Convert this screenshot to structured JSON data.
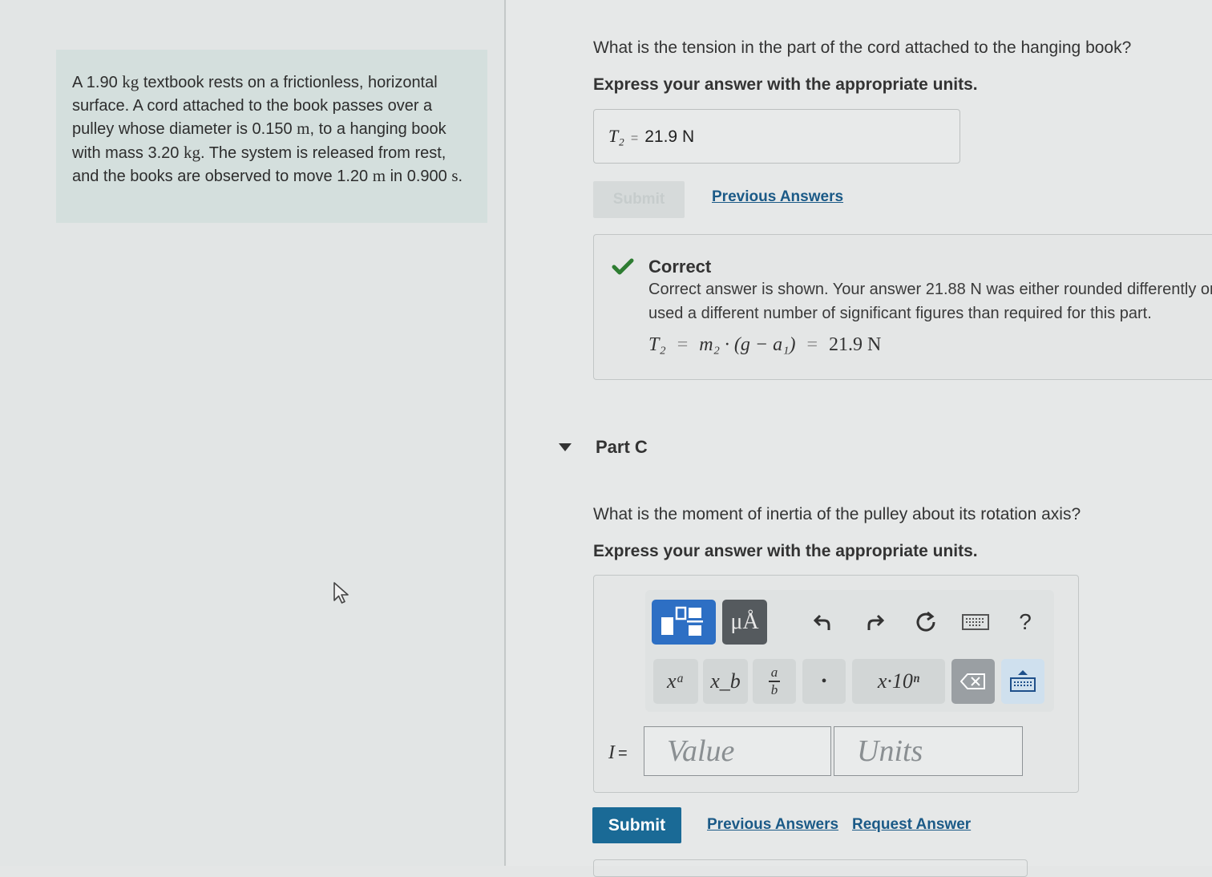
{
  "problem": {
    "seg1": "A 1.90 ",
    "u1": "kg",
    "seg2": " textbook rests on a frictionless, horizontal surface. A cord attached to the book passes over a pulley whose diameter is 0.150 ",
    "u2": "m",
    "seg3": ", to a hanging book with mass 3.20 ",
    "u3": "kg",
    "seg4": ". The system is released from rest, and the books are observed to move 1.20 ",
    "u4": "m",
    "seg5": " in 0.900 ",
    "u5": "s",
    "seg6": "."
  },
  "part_b": {
    "question": "What is the tension in the part of the cord attached to the hanging book?",
    "instruction": "Express your answer with the appropriate units.",
    "answer_var": "T₂",
    "answer_eq": "=",
    "answer_value": "21.9 N",
    "submit_label": "Submit",
    "previous_answers_label": "Previous Answers",
    "feedback": {
      "title": "Correct",
      "message": "Correct answer is shown. Your answer 21.88 N was either rounded differently or used a different number of significant figures than required for this part.",
      "equation_lhs": "T₂",
      "equation_mid": "m₂ · (g − a₁)",
      "equation_rhs": "21.9 N",
      "equals": "="
    }
  },
  "part_c": {
    "label": "Part C",
    "question": "What is the moment of inertia of the pulley about its rotation axis?",
    "instruction": "Express your answer with the appropriate units.",
    "toolbar": {
      "units_button": "μÅ",
      "help_label": "?",
      "keys": {
        "superscript": "xᵃ",
        "subscript": "x_b",
        "fraction_num": "a",
        "fraction_den": "b",
        "dot": "•",
        "scientific": "x·10ⁿ"
      }
    },
    "input_label": "I",
    "input_eq": "=",
    "value_placeholder": "Value",
    "units_placeholder": "Units",
    "submit_label": "Submit",
    "previous_answers_label": "Previous Answers",
    "request_answer_label": "Request Answer"
  },
  "colors": {
    "correct_check": "#2e7d32",
    "primary_button": "#1a6a96",
    "link": "#1b5a87",
    "problem_bg": "#d4dfdd"
  },
  "icons": [
    "templates-icon",
    "units-icon",
    "undo-icon",
    "redo-icon",
    "reset-icon",
    "keyboard-icon",
    "help-icon",
    "backspace-icon",
    "keyboard-toggle-icon",
    "checkmark-icon",
    "collapse-triangle-icon",
    "mouse-cursor-icon"
  ]
}
